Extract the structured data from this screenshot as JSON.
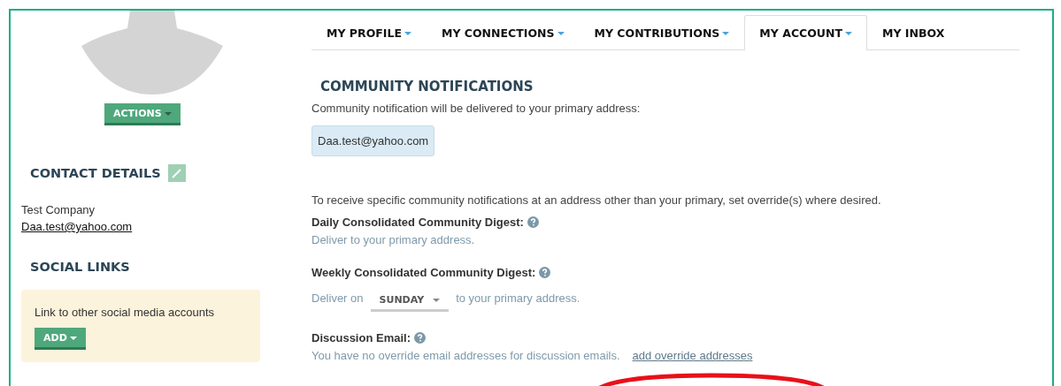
{
  "sidebar": {
    "actions_button": "ACTIONS",
    "contact_heading": "CONTACT DETAILS",
    "company": "Test Company",
    "email": "Daa.test@yahoo.com",
    "social_heading": "SOCIAL LINKS",
    "social_card": {
      "text": "Link to other social media accounts",
      "button": "ADD"
    }
  },
  "tabs": [
    {
      "label": "MY PROFILE",
      "caret": true,
      "selected": false
    },
    {
      "label": "MY CONNECTIONS",
      "caret": true,
      "selected": false
    },
    {
      "label": "MY CONTRIBUTIONS",
      "caret": true,
      "selected": false
    },
    {
      "label": "MY ACCOUNT",
      "caret": true,
      "selected": true
    },
    {
      "label": "MY INBOX",
      "caret": false,
      "selected": false
    }
  ],
  "section": {
    "heading": "COMMUNITY NOTIFICATIONS",
    "intro": "Community notification will be delivered to your primary address:",
    "primary_email": "Daa.test@yahoo.com",
    "override_note": "To receive specific community notifications at an address other than your primary, set override(s) where desired.",
    "settings": [
      {
        "kind": "text",
        "label": "Daily Consolidated Community Digest:",
        "help": true,
        "text": "Deliver to your primary address."
      },
      {
        "kind": "dropdown",
        "label": "Weekly Consolidated Community Digest:",
        "help": true,
        "before": "Deliver on",
        "value": "SUNDAY",
        "after": "to your primary address."
      },
      {
        "kind": "link",
        "label": "Discussion Email:",
        "help": true,
        "text": "You have no override email addresses for discussion emails.",
        "link": "add override addresses"
      }
    ]
  }
}
